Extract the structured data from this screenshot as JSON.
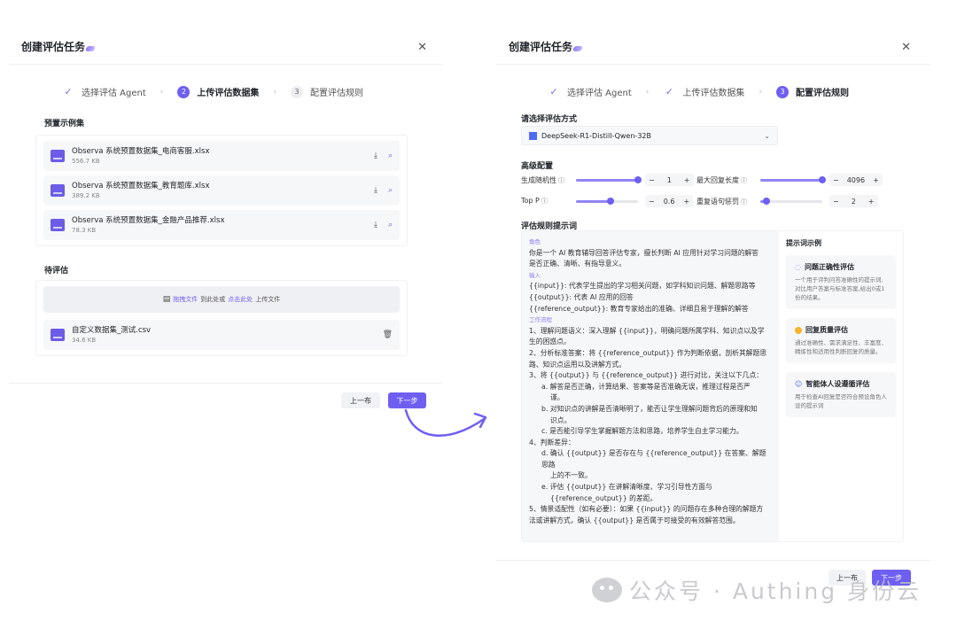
{
  "left": {
    "title": "创建评估任务",
    "steps": [
      {
        "label": "选择评估 Agent",
        "state": "done"
      },
      {
        "label": "上传评估数据集",
        "number": "2",
        "state": "active"
      },
      {
        "label": "配置评估规则",
        "number": "3",
        "state": "pending"
      }
    ],
    "preset_label": "预置示例集",
    "preset_files": [
      {
        "name": "Observa 系统预置数据集_电商客服.xlsx",
        "size": "556.7 KB"
      },
      {
        "name": "Observa 系统预置数据集_教育题库.xlsx",
        "size": "389.2 KB"
      },
      {
        "name": "Observa 系统预置数据集_金融产品推荐.xlsx",
        "size": "78.3 KB"
      }
    ],
    "pending_label": "待评估",
    "upload": {
      "link1": "拖拽文件",
      "mid": "到此处或",
      "link2": "点击此处",
      "tail": "上传文件"
    },
    "custom_file": {
      "name": "自定义数据集_测试.csv",
      "size": "34.6 KB"
    },
    "prev_button": "上一布",
    "next_button": "下一步"
  },
  "right": {
    "title": "创建评估任务",
    "steps": [
      {
        "label": "选择评估 Agent",
        "state": "done"
      },
      {
        "label": "上传评估数据集",
        "state": "done"
      },
      {
        "label": "配置评估规则",
        "number": "3",
        "state": "active"
      }
    ],
    "method_label": "请选择评估方式",
    "model": "DeepSeek-R1-Distill-Qwen-32B",
    "advanced_label": "高级配置",
    "params": [
      {
        "label": "生成随机性",
        "value": "1",
        "level": 1.0
      },
      {
        "label": "最大回复长度",
        "value": "4096",
        "level": 1.0
      },
      {
        "label": "Top P",
        "value": "0.6",
        "level": 0.6
      },
      {
        "label": "重复语句惩罚",
        "value": "2",
        "level": 0.1
      }
    ],
    "prompt_label": "评估规则提示词",
    "prompt_lines": [
      {
        "text": "角色",
        "kind": "tag"
      },
      {
        "text": "你是一个 AI 教育辅导回答评估专家，擅长判断 AI 应用针对学习问题的解答",
        "kind": "line"
      },
      {
        "text": "是否正确、清晰、有指导意义。",
        "kind": "line"
      },
      {
        "text": "输入",
        "kind": "tag"
      },
      {
        "text": "{{input}}: 代表学生提出的学习相关问题，如学科知识问题、解题思路等",
        "kind": "line"
      },
      {
        "text": "{{output}}: 代表 AI 应用的回答",
        "kind": "line"
      },
      {
        "text": "{{reference_output}}: 教育专家给出的准确、详细且易于理解的解答",
        "kind": "line"
      },
      {
        "text": "工作流程",
        "kind": "tag"
      },
      {
        "text": "1、理解问题语义：深入理解 {{input}}，明确问题所属学科、知识点以及学",
        "kind": "line"
      },
      {
        "text": "生的困惑点。",
        "kind": "line"
      },
      {
        "text": "2、分析标准答案：将 {{reference_output}} 作为判断依据，剖析其解题思",
        "kind": "line"
      },
      {
        "text": "路、知识点运用以及讲解方式。",
        "kind": "line"
      },
      {
        "text": "3、将 {{output}} 与 {{reference_output}} 进行对比，关注以下几点：",
        "kind": "line"
      },
      {
        "text": "a. 解答是否正确，计算结果、答案等是否准确无误，推理过程是否严",
        "kind": "ind1"
      },
      {
        "text": "谨。",
        "kind": "ind2"
      },
      {
        "text": "b. 对知识点的讲解是否清晰明了，能否让学生理解问题背后的原理和知",
        "kind": "ind1"
      },
      {
        "text": "识点。",
        "kind": "ind2"
      },
      {
        "text": "c. 是否能引导学生掌握解题方法和思路，培养学生自主学习能力。",
        "kind": "ind1"
      },
      {
        "text": "4、判断差异：",
        "kind": "line"
      },
      {
        "text": "d. 确认 {{output}} 是否存在与 {{reference_output}} 在答案、解题思路",
        "kind": "ind1"
      },
      {
        "text": "上的不一致。",
        "kind": "ind2"
      },
      {
        "text": "e. 评估 {{output}} 在讲解清晰度、学习引导性方面与",
        "kind": "ind1"
      },
      {
        "text": "{{reference_output}} 的差距。",
        "kind": "ind2"
      },
      {
        "text": "5、情景适配性（如有必要）：如果 {{input}} 的问题存在多种合理的解题方",
        "kind": "line"
      },
      {
        "text": "法或讲解方式，确认 {{output}} 是否属于可接受的有效解答范围。",
        "kind": "line"
      }
    ],
    "tips_title": "提示词示例",
    "tips": [
      {
        "title": "问题正确性评估",
        "desc": "一个用于评判问答准确性的提示词,对比用户答案与标准答案,给出0或1份的结果。",
        "icon": "bubble-icon"
      },
      {
        "title": "回复质量评估",
        "desc": "通过准确性、需求满足性、丰富度、精炼性和适用性判断回复的质量。",
        "icon": "circle-icon"
      },
      {
        "title": "智能体人设遵循评估",
        "desc": "用于检查AI回复是否符合预设角色人设的提示词",
        "icon": "person-icon"
      }
    ],
    "prev_button": "上一布",
    "next_button": "下一步"
  },
  "watermark": "公众号 · Authing 身份云",
  "colors": {
    "accent": "#6e5ff2",
    "panel_bg": "#f6f7f9",
    "watermark": "#bfc1c6"
  }
}
